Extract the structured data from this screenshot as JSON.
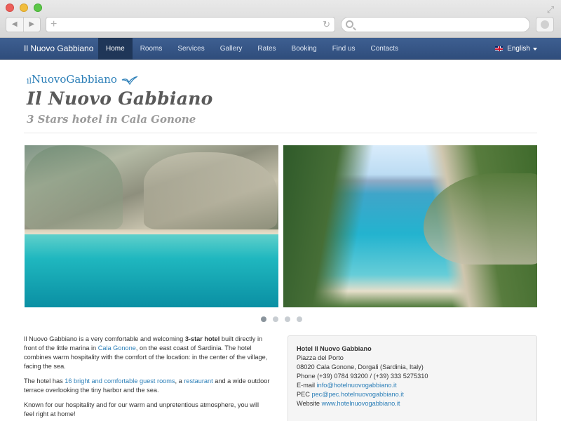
{
  "site": {
    "brand": "Il Nuovo Gabbiano",
    "nav": [
      {
        "label": "Home",
        "active": true
      },
      {
        "label": "Rooms"
      },
      {
        "label": "Services"
      },
      {
        "label": "Gallery"
      },
      {
        "label": "Rates"
      },
      {
        "label": "Booking"
      },
      {
        "label": "Find us"
      },
      {
        "label": "Contacts"
      }
    ],
    "language": "English"
  },
  "header": {
    "logo_small": "il",
    "logo_big": "NuovoGabbiano",
    "title": "Il Nuovo Gabbiano",
    "subtitle": "3 Stars hotel in Cala Gonone"
  },
  "carousel": {
    "slides_count": 4,
    "active_slide": 1
  },
  "intro": {
    "p1_a": "Il Nuovo Gabbiano is a very comfortable and welcoming ",
    "p1_bold": "3-star hotel",
    "p1_b": " built directly in front of the little marina in ",
    "p1_link": "Cala Gonone",
    "p1_c": ", on the east coast of Sardinia. The hotel combines warm hospitality with the comfort of the location: in the center of the village, facing the sea.",
    "p2_a": "The hotel has ",
    "p2_link1": "16 bright and comfortable guest rooms",
    "p2_b": ", a ",
    "p2_link2": "restaurant",
    "p2_c": " and a wide outdoor terrace overlooking the tiny harbor and the sea.",
    "p3": "Known for our hospitality and for our warm and unpretentious atmosphere, you will feel right at home!"
  },
  "contact": {
    "name": "Hotel Il Nuovo Gabbiano",
    "street": "Piazza del Porto",
    "city": "08020 Cala Gonone, Dorgali (Sardinia, Italy)",
    "phone": "Phone (+39) 0784 93200 / (+39) 333 5275310",
    "email_label": "E-mail ",
    "email": "info@hotelnuovogabbiano.it",
    "pec_label": "PEC ",
    "pec": "pec@pec.hotelnuovogabbiano.it",
    "website_label": "Website ",
    "website": "www.hotelnuovogabbiano.it"
  },
  "colors": {
    "navbar": "#34558a",
    "link": "#2c7fb8"
  }
}
